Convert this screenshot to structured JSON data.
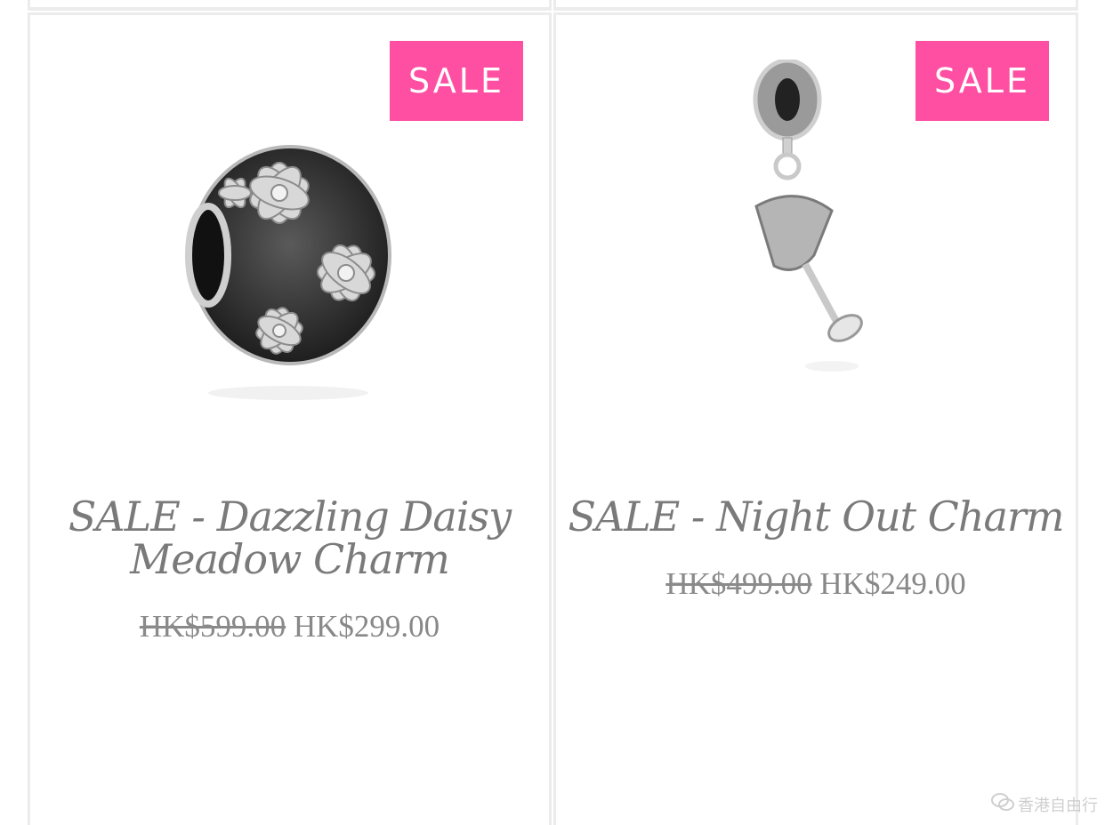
{
  "products": [
    {
      "badge": "SALE",
      "title_line1": "SALE - Dazzling Daisy",
      "title_line2": "Meadow Charm",
      "old_price": "HK$599.00",
      "new_price": "HK$299.00"
    },
    {
      "badge": "SALE",
      "title_line1": "SALE - Night Out Charm",
      "old_price": "HK$499.00",
      "new_price": "HK$249.00"
    }
  ],
  "watermark": {
    "text": "香港自由行",
    "icon": "wechat-icon"
  },
  "colors": {
    "badge": "#ff4fa3",
    "text": "#7a7a7a",
    "border": "#ececec"
  }
}
